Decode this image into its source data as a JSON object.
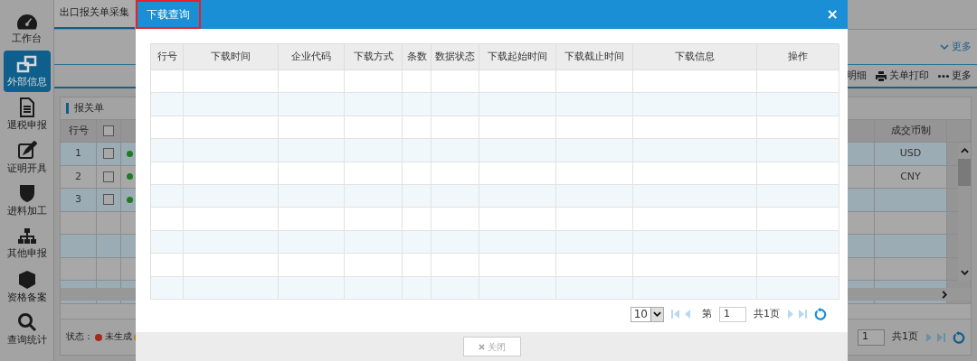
{
  "sidebar": {
    "items": [
      {
        "label": "工作台",
        "kind": "dashboard",
        "selected": false
      },
      {
        "label": "外部信息",
        "kind": "windows",
        "selected": true
      },
      {
        "label": "退税申报",
        "kind": "document",
        "selected": false
      },
      {
        "label": "证明开具",
        "kind": "edit",
        "selected": false
      },
      {
        "label": "进料加工",
        "kind": "shield",
        "selected": false
      },
      {
        "label": "其他申报",
        "kind": "sitemap",
        "selected": false
      },
      {
        "label": "资格备案",
        "kind": "cube",
        "selected": false
      },
      {
        "label": "查询统计",
        "kind": "search",
        "selected": false
      }
    ]
  },
  "tabs": [
    {
      "label": "出口报关单采集",
      "selected": true
    }
  ],
  "filter_bar": {
    "more": "更多"
  },
  "toolbar": {
    "buttons": [
      {
        "label": "明细",
        "kind": "plain"
      },
      {
        "label": "关单打印",
        "kind": "print"
      },
      {
        "label": "更多",
        "kind": "more"
      }
    ]
  },
  "panel": {
    "title": "报关单",
    "table": {
      "columns": {
        "row_no": "行号",
        "currency": "成交币制"
      },
      "header_checked": false,
      "rows": [
        {
          "row_no": "1",
          "checked": false,
          "color": "#1f7a22",
          "currency": "USD"
        },
        {
          "row_no": "2",
          "checked": false,
          "color": "#1f7a22",
          "currency": "CNY"
        },
        {
          "row_no": "3",
          "checked": false,
          "color": "#1f7a22"
        }
      ]
    }
  },
  "status_legend": {
    "label": "状态：",
    "items": [
      {
        "label": "未生成",
        "color": "#a8281e"
      },
      {
        "color": "#b3801c"
      }
    ]
  },
  "pagination": {
    "page": "1",
    "total": "共1页"
  },
  "dialog": {
    "title": "下载查询",
    "title_highlighted": true,
    "close": "×",
    "table": {
      "columns": [
        "行号",
        "下载时间",
        "企业代码",
        "下载方式",
        "条数",
        "数据状态",
        "下载起始时间",
        "下载截止时间",
        "下载信息",
        "操作"
      ]
    },
    "pagination": {
      "page_size": "10",
      "page_label": "第",
      "page": "1",
      "total": "共1页"
    },
    "footer_button": "关闭"
  }
}
